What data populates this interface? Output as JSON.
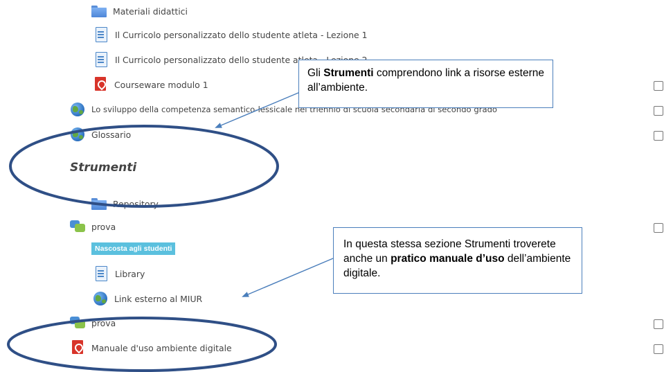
{
  "items": [
    {
      "type": "folder",
      "label": "Materiali didattici"
    },
    {
      "type": "page",
      "label": "Il Curricolo personalizzato dello studente atleta - Lezione 1"
    },
    {
      "type": "page",
      "label": "Il Curricolo personalizzato dello studente atleta - Lezione 2"
    },
    {
      "type": "pdf",
      "label": "Courseware modulo 1"
    },
    {
      "type": "url",
      "label": "Lo sviluppo della competenza semantico-lessicale nel triennio di scuola secondaria di secondo grado"
    },
    {
      "type": "url",
      "label": "Glossario"
    },
    {
      "type": "folder",
      "label": "Repository"
    },
    {
      "type": "forum",
      "label": "prova"
    },
    {
      "type": "page",
      "label": "Library"
    },
    {
      "type": "url",
      "label": "Link esterno al MIUR"
    },
    {
      "type": "forum",
      "label": "prova"
    },
    {
      "type": "pdf",
      "label": "Manuale d'uso ambiente digitale"
    }
  ],
  "section_heading": "Strumenti",
  "hidden_badge": "Nascosta agli studenti",
  "callout1": {
    "pre": "Gli ",
    "bold": "Strumenti",
    "post": " comprendono link a risorse esterne all’ambiente."
  },
  "callout2": {
    "pre": "In questa stessa sezione Strumenti troverete anche un ",
    "bold": "pratico manuale d’uso",
    "post": " dell’ambiente digitale."
  },
  "colors": {
    "annotation": "#2f4f86",
    "callout_border": "#4a7ebb",
    "badge": "#5bc0de"
  }
}
